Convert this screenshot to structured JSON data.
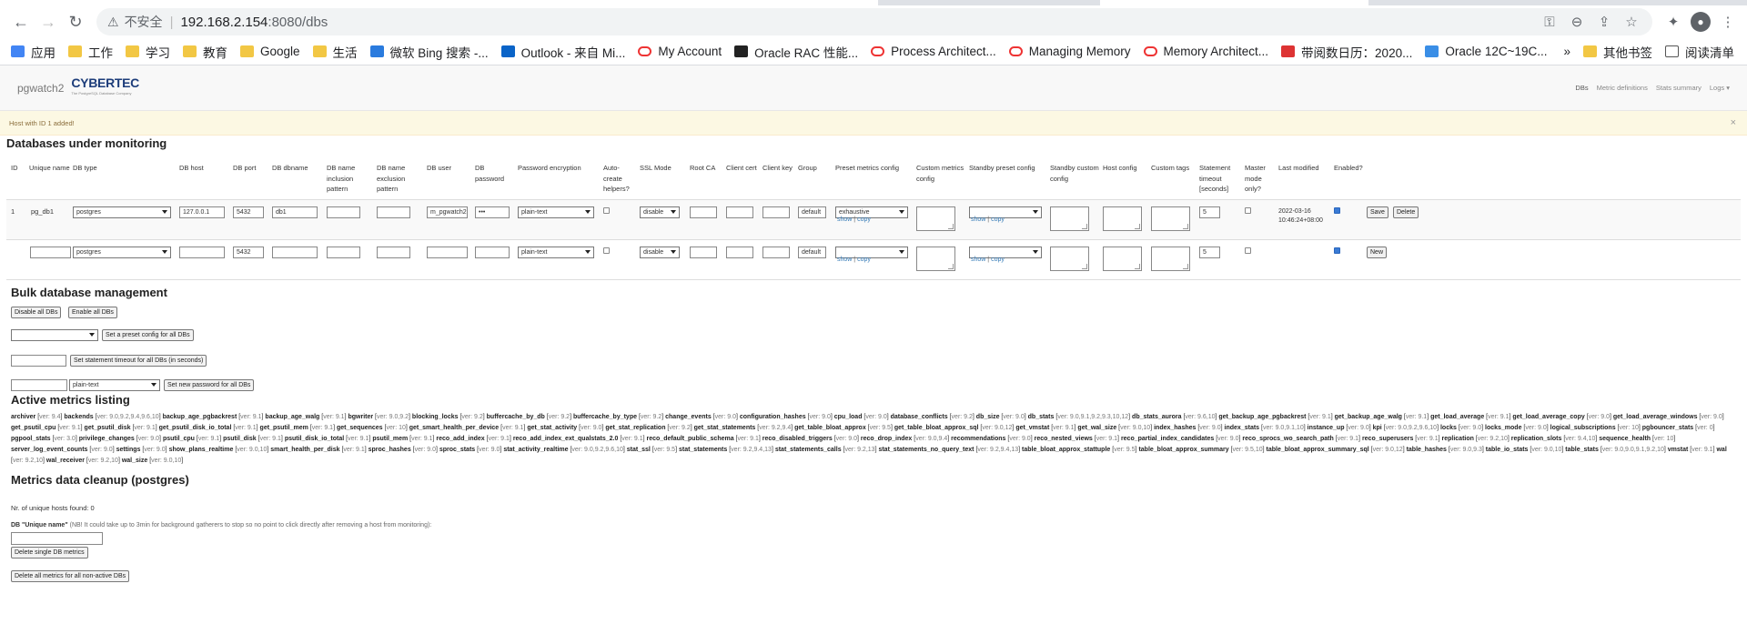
{
  "browser": {
    "insecure_label": "不安全",
    "url_host": "192.168.2.154",
    "url_path": ":8080/dbs",
    "bookmarks": [
      {
        "label": "应用",
        "icon": "apps-grid-icon"
      },
      {
        "label": "工作",
        "icon": "folder-icon"
      },
      {
        "label": "学习",
        "icon": "folder-icon"
      },
      {
        "label": "教育",
        "icon": "folder-icon"
      },
      {
        "label": "Google",
        "icon": "folder-icon"
      },
      {
        "label": "生活",
        "icon": "folder-icon"
      },
      {
        "label": "微软 Bing 搜索 -...",
        "icon": "bing-icon"
      },
      {
        "label": "Outlook - 来自 Mi...",
        "icon": "outlook-icon"
      },
      {
        "label": "My Account",
        "icon": "oracle-icon"
      },
      {
        "label": "Oracle RAC 性能...",
        "icon": "m-logo-icon"
      },
      {
        "label": "Process Architect...",
        "icon": "oracle-icon"
      },
      {
        "label": "Managing Memory",
        "icon": "oracle-icon"
      },
      {
        "label": "Memory Architect...",
        "icon": "oracle-icon"
      },
      {
        "label": "带阅数日历：2020...",
        "icon": "calendar-icon"
      },
      {
        "label": "Oracle 12C~19C...",
        "icon": "site-icon"
      }
    ],
    "bookmarks_more": "»",
    "other_bookmarks": "其他书签",
    "reading_list": "阅读清单"
  },
  "app": {
    "brand": "pgwatch2",
    "logo": "CYBERTEC",
    "logo_sub": "The PostgreSQL Database Company",
    "nav": [
      "DBs",
      "Metric definitions",
      "Stats summary",
      "Logs ▾"
    ],
    "alert": "Host with ID 1 added!",
    "alert_close": "×"
  },
  "monitoring": {
    "title": "Databases under monitoring",
    "headers": [
      "ID",
      "Unique name",
      "DB type",
      "DB host",
      "DB port",
      "DB dbname",
      "DB name inclusion pattern",
      "DB name exclusion pattern",
      "DB user",
      "DB password",
      "Password encryption",
      "Auto-create helpers?",
      "SSL Mode",
      "Root CA",
      "Client cert",
      "Client key",
      "Group",
      "Preset metrics config",
      "Custom metrics config",
      "Standby preset config",
      "Standby custom config",
      "Host config",
      "Custom tags",
      "Statement timeout [seconds]",
      "Master mode only?",
      "Last modified",
      "Enabled?"
    ],
    "rows": [
      {
        "id": "1",
        "unique_name": "pg_db1",
        "db_type": "postgres",
        "host": "127.0.0.1",
        "port": "5432",
        "dbname": "db1",
        "user": "m_pgwatch2",
        "password": "•••",
        "pw_enc": "plain-text",
        "ssl": "disable",
        "group": "default",
        "preset": "exhaustive",
        "timeout": "5",
        "last_modified": "2022-03-16 10:46:24+08:00",
        "show": "show",
        "copy": "copy",
        "save": "Save",
        "delete": "Delete"
      },
      {
        "id": "",
        "unique_name": "",
        "db_type": "postgres",
        "host": "",
        "port": "5432",
        "dbname": "",
        "user": "",
        "password": "",
        "pw_enc": "plain-text",
        "ssl": "disable",
        "group": "default",
        "preset": "",
        "timeout": "5",
        "last_modified": "",
        "show": "show",
        "copy": "copy",
        "new": "New"
      }
    ]
  },
  "bulk": {
    "title": "Bulk database management",
    "disable_all": "Disable all DBs",
    "enable_all": "Enable all DBs",
    "set_preset": "Set a preset config for all DBs",
    "set_timeout": "Set statement timeout for all DBs (in seconds)",
    "pw_enc": "plain-text",
    "set_password": "Set new password for all DBs"
  },
  "metrics": {
    "title": "Active metrics listing",
    "items": [
      [
        "archiver",
        "ver: 9.4"
      ],
      [
        "backends",
        "ver: 9.0,9.2,9.4,9.6,10"
      ],
      [
        "backup_age_pgbackrest",
        "ver: 9.1"
      ],
      [
        "backup_age_walg",
        "ver: 9.1"
      ],
      [
        "bgwriter",
        "ver: 9.0,9.2"
      ],
      [
        "blocking_locks",
        "ver: 9.2"
      ],
      [
        "buffercache_by_db",
        "ver: 9.2"
      ],
      [
        "buffercache_by_type",
        "ver: 9.2"
      ],
      [
        "change_events",
        "ver: 9.0"
      ],
      [
        "configuration_hashes",
        "ver: 9.0"
      ],
      [
        "cpu_load",
        "ver: 9.0"
      ],
      [
        "database_conflicts",
        "ver: 9.2"
      ],
      [
        "db_size",
        "ver: 9.0"
      ],
      [
        "db_stats",
        "ver: 9.0,9.1,9.2,9.3,10,12"
      ],
      [
        "db_stats_aurora",
        "ver: 9.6,10"
      ],
      [
        "get_backup_age_pgbackrest",
        "ver: 9.1"
      ],
      [
        "get_backup_age_walg",
        "ver: 9.1"
      ],
      [
        "get_load_average",
        "ver: 9.1"
      ],
      [
        "get_load_average_copy",
        "ver: 9.0"
      ],
      [
        "get_load_average_windows",
        "ver: 9.0"
      ],
      [
        "get_psutil_cpu",
        "ver: 9.1"
      ],
      [
        "get_psutil_disk",
        "ver: 9.1"
      ],
      [
        "get_psutil_disk_io_total",
        "ver: 9.1"
      ],
      [
        "get_psutil_mem",
        "ver: 9.1"
      ],
      [
        "get_sequences",
        "ver: 10"
      ],
      [
        "get_smart_health_per_device",
        "ver: 9.1"
      ],
      [
        "get_stat_activity",
        "ver: 9.0"
      ],
      [
        "get_stat_replication",
        "ver: 9.2"
      ],
      [
        "get_stat_statements",
        "ver: 9.2,9.4"
      ],
      [
        "get_table_bloat_approx",
        "ver: 9.5"
      ],
      [
        "get_table_bloat_approx_sql",
        "ver: 9.0,12"
      ],
      [
        "get_vmstat",
        "ver: 9.1"
      ],
      [
        "get_wal_size",
        "ver: 9.0,10"
      ],
      [
        "index_hashes",
        "ver: 9.0"
      ],
      [
        "index_stats",
        "ver: 9.0,9.1,10"
      ],
      [
        "instance_up",
        "ver: 9.0"
      ],
      [
        "kpi",
        "ver: 9.0,9.2,9.6,10"
      ],
      [
        "locks",
        "ver: 9.0"
      ],
      [
        "locks_mode",
        "ver: 9.0"
      ],
      [
        "logical_subscriptions",
        "ver: 10"
      ],
      [
        "pgbouncer_stats",
        "ver: 0"
      ],
      [
        "pgpool_stats",
        "ver: 3.0"
      ],
      [
        "privilege_changes",
        "ver: 9.0"
      ],
      [
        "psutil_cpu",
        "ver: 9.1"
      ],
      [
        "psutil_disk",
        "ver: 9.1"
      ],
      [
        "psutil_disk_io_total",
        "ver: 9.1"
      ],
      [
        "psutil_mem",
        "ver: 9.1"
      ],
      [
        "reco_add_index",
        "ver: 9.1"
      ],
      [
        "reco_add_index_ext_qualstats_2.0",
        "ver: 9.1"
      ],
      [
        "reco_default_public_schema",
        "ver: 9.1"
      ],
      [
        "reco_disabled_triggers",
        "ver: 9.0"
      ],
      [
        "reco_drop_index",
        "ver: 9.0,9.4"
      ],
      [
        "recommendations",
        "ver: 9.0"
      ],
      [
        "reco_nested_views",
        "ver: 9.1"
      ],
      [
        "reco_partial_index_candidates",
        "ver: 9.0"
      ],
      [
        "reco_sprocs_wo_search_path",
        "ver: 9.1"
      ],
      [
        "reco_superusers",
        "ver: 9.1"
      ],
      [
        "replication",
        "ver: 9.2,10"
      ],
      [
        "replication_slots",
        "ver: 9.4,10"
      ],
      [
        "sequence_health",
        "ver: 10"
      ],
      [
        "server_log_event_counts",
        "ver: 9.0"
      ],
      [
        "settings",
        "ver: 9.0"
      ],
      [
        "show_plans_realtime",
        "ver: 9.0,10"
      ],
      [
        "smart_health_per_disk",
        "ver: 9.1"
      ],
      [
        "sproc_hashes",
        "ver: 9.0"
      ],
      [
        "sproc_stats",
        "ver: 9.0"
      ],
      [
        "stat_activity_realtime",
        "ver: 9.0,9.2,9.6,10"
      ],
      [
        "stat_ssl",
        "ver: 9.5"
      ],
      [
        "stat_statements",
        "ver: 9.2,9.4,13"
      ],
      [
        "stat_statements_calls",
        "ver: 9.2,13"
      ],
      [
        "stat_statements_no_query_text",
        "ver: 9.2,9.4,13"
      ],
      [
        "table_bloat_approx_stattuple",
        "ver: 9.5"
      ],
      [
        "table_bloat_approx_summary",
        "ver: 9.5,10"
      ],
      [
        "table_bloat_approx_summary_sql",
        "ver: 9.0,12"
      ],
      [
        "table_hashes",
        "ver: 9.0,9.3"
      ],
      [
        "table_io_stats",
        "ver: 9.0,10"
      ],
      [
        "table_stats",
        "ver: 9.0,9.0,9.1,9.2,10"
      ],
      [
        "vmstat",
        "ver: 9.1"
      ],
      [
        "wal",
        "ver: 9.2,10"
      ],
      [
        "wal_receiver",
        "ver: 9.2,10"
      ],
      [
        "wal_size",
        "ver: 9.0,10"
      ]
    ]
  },
  "cleanup": {
    "title": "Metrics data cleanup (postgres)",
    "unique_hosts": "Nr. of unique hosts found: 0",
    "unique_name_label": "DB \"Unique name\"",
    "note": "(NB! It could take up to 3min for background gatherers to stop so no point to click directly after removing a host from monitoring):",
    "delete_single": "Delete single DB metrics",
    "delete_all": "Delete all metrics for all non-active DBs"
  }
}
